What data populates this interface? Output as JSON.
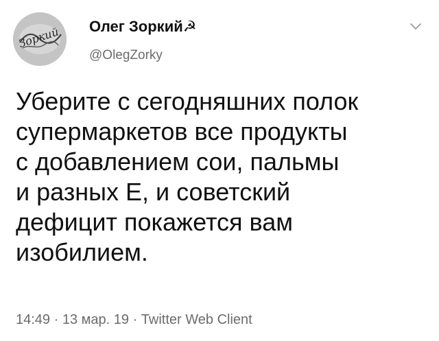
{
  "tweet": {
    "author": {
      "display_name": "Олег Зоркий☭",
      "handle": "@OlegZorky",
      "avatar_text": "Зоркий"
    },
    "text_lines": [
      "Уберите с сегодняшних полок",
      "супермаркетов все продукты",
      "с добавлением сои, пальмы",
      "и разных Е, и советский",
      "дефицит покажется вам",
      "изобилием."
    ],
    "meta": {
      "time": "14:49",
      "separator_1": " · ",
      "date": "13 мар. 19",
      "separator_2": " · ",
      "client": "Twitter Web Client"
    }
  },
  "icons": {
    "menu": "chevron-down-icon",
    "avatar": "avatar-image"
  },
  "colors": {
    "text": "#111111",
    "secondary_text": "#6b6b6b",
    "background": "#ffffff"
  }
}
